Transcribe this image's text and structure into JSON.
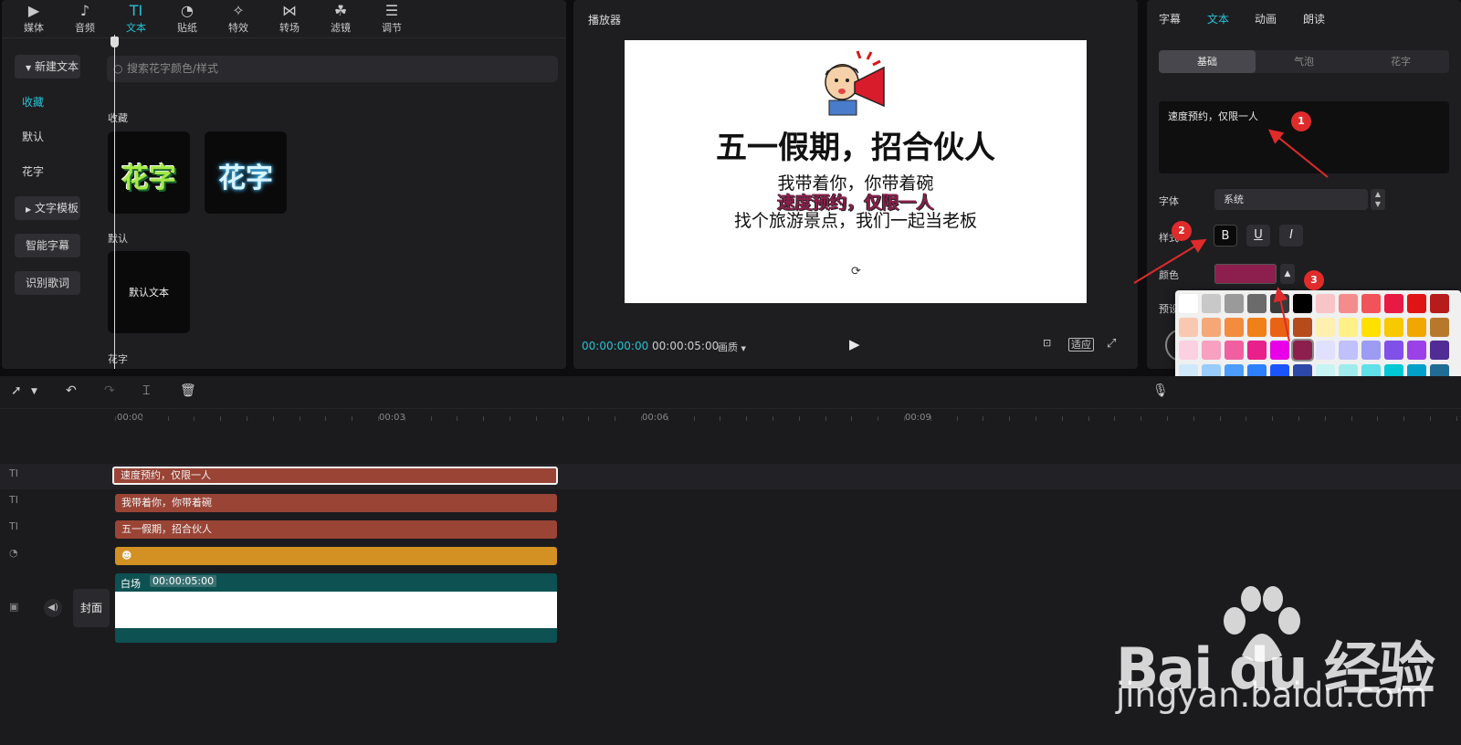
{
  "top_nav": [
    {
      "label": "媒体",
      "icon": "media-icon"
    },
    {
      "label": "音频",
      "icon": "audio-icon"
    },
    {
      "label": "文本",
      "icon": "text-icon",
      "glyph": "TI"
    },
    {
      "label": "贴纸",
      "icon": "sticker-icon"
    },
    {
      "label": "特效",
      "icon": "effects-icon"
    },
    {
      "label": "转场",
      "icon": "transition-icon"
    },
    {
      "label": "滤镜",
      "icon": "filter-icon"
    },
    {
      "label": "调节",
      "icon": "adjust-icon"
    }
  ],
  "sidebar": {
    "new_text": "新建文本",
    "favorites": "收藏",
    "default": "默认",
    "fancy": "花字",
    "text_template": "文字模板",
    "smart_caption": "智能字幕",
    "lyrics": "识别歌词"
  },
  "library": {
    "search_placeholder": "搜索花字颜色/样式",
    "favorites_label": "收藏",
    "fancy_sample": "花字",
    "default_label": "默认",
    "default_text": "默认文本",
    "fancy_label": "花字"
  },
  "player": {
    "title": "播放器",
    "canvas_title": "五一假期，招合伙人",
    "line1": "我带着你，你带着碗",
    "line2": "速度预约，仅限一人",
    "line3": "找个旅游景点，我们一起当老板",
    "time_current": "00:00:00:00",
    "time_total": "00:00:05:00",
    "ratio": "画质",
    "fit": "适应"
  },
  "properties": {
    "tabs": [
      "字幕",
      "文本",
      "动画",
      "朗读"
    ],
    "active_tab": "文本",
    "subtabs": [
      "基础",
      "气泡",
      "花字"
    ],
    "text_value": "速度预约，仅限一人",
    "font_label": "字体",
    "font_value": "系统",
    "style_label": "样式",
    "style_buttons": [
      "B",
      "U",
      "I"
    ],
    "color_label": "颜色",
    "preset_label": "预设",
    "selected_color": "#8c1f4d"
  },
  "palette": {
    "rows": [
      [
        "#ffffff",
        "#c8c8c8",
        "#9a9a9a",
        "#6b6b6b",
        "#3a3a3a",
        "#000000",
        "#f8c4c8",
        "#f48c8c",
        "#f0545a",
        "#e81a44",
        "#e01414",
        "#b61c1c"
      ],
      [
        "#f8c8b0",
        "#f4a878",
        "#f48c40",
        "#f08018",
        "#e86414",
        "#b64c1c",
        "#fff0b0",
        "#fff088",
        "#ffe000",
        "#f8c800",
        "#f0a800",
        "#b8782c"
      ],
      [
        "#fcd0e0",
        "#f8a0c0",
        "#f060a0",
        "#e8208c",
        "#e800e8",
        "#8c1f4d",
        "#e0e0ff",
        "#c0c0fc",
        "#9c9cf4",
        "#8050e8",
        "#9c40e8",
        "#502c94"
      ],
      [
        "#d0e8fc",
        "#98ccfc",
        "#4c9cfc",
        "#2c80fc",
        "#1c54fc",
        "#2c48a8",
        "#c8f4f4",
        "#a0ecec",
        "#60e0e8",
        "#00c8d4",
        "#00a0c8",
        "#206c94"
      ],
      [
        "#c0f4d0",
        "#7cec9c",
        "#24e060",
        "#20c844",
        "#109c30",
        "#2c7c40",
        "#f0f4c0",
        "#e0ec80",
        "#c8d448",
        "#8cb020",
        "#609020",
        "#3c6c28"
      ],
      [
        "#d8c8c4",
        "#b49c94",
        "#94746c",
        "#745450",
        "#54403c",
        "#3c302c",
        "#ecc8b8",
        "#d88070",
        "#b85850",
        "#a83838",
        "#e8b8a0",
        "#c89070"
      ],
      [
        "#e8c8a0",
        "#e8c060",
        "#c0a858",
        "#b49c64",
        "#8c8c64",
        "#647c60",
        "#3c6c54",
        "#00a090",
        "#00847c",
        "#84c8c0",
        "#60a8b8",
        "#3c7c94"
      ],
      [
        "#a0b0c8",
        "#6484c4",
        "#3c5c94",
        "#ccb4c8",
        "#a88cb0",
        "#6c4c78"
      ]
    ]
  },
  "timeline": {
    "ruler_labels": [
      "00:00",
      "00:03",
      "00:06",
      "00:09"
    ],
    "clips": [
      {
        "label": "速度预约，仅限一人"
      },
      {
        "label": "我带着你，你带着碗"
      },
      {
        "label": "五一假期，招合伙人"
      }
    ],
    "video_label": "白场",
    "video_duration": "00:00:05:00",
    "cover_label": "封面"
  },
  "annotations": [
    "1",
    "2",
    "3"
  ],
  "watermark": {
    "brand": "Bai du 经验",
    "url": "jingyan.baidu.com"
  }
}
